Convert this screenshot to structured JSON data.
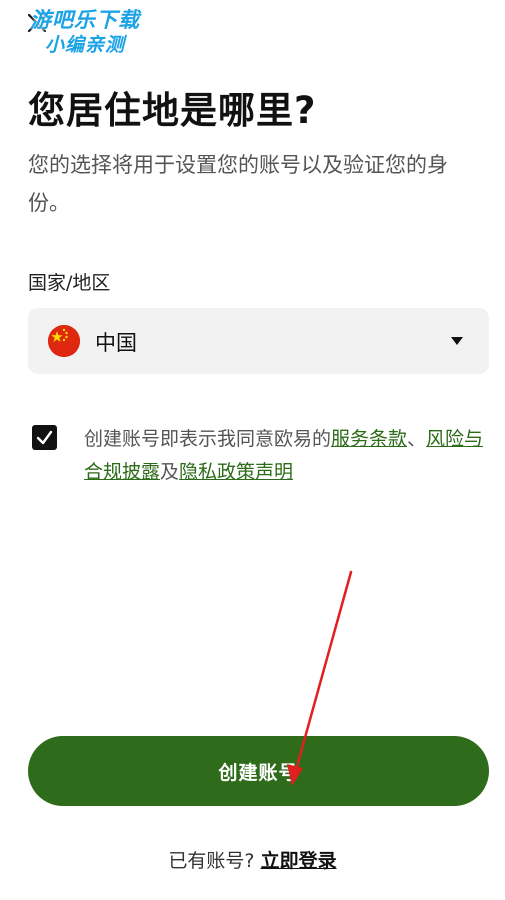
{
  "watermark": {
    "line1": "游吧乐下载",
    "line2": "小编亲测"
  },
  "page": {
    "title": "您居住地是哪里?",
    "subtitle": "您的选择将用于设置您的账号以及验证您的身份。"
  },
  "country": {
    "label": "国家/地区",
    "selected": "中国",
    "flag_icon": "china-flag-icon"
  },
  "terms": {
    "checked": true,
    "prefix": "创建账号即表示我同意欧易的",
    "link_terms": "服务条款",
    "sep1": "、",
    "link_risk": "风险与合规披露",
    "sep2": "及",
    "link_privacy": "隐私政策声明"
  },
  "actions": {
    "create_account": "创建账号",
    "have_account": "已有账号?",
    "login": "立即登录"
  },
  "colors": {
    "brand_green": "#2e6b1a",
    "link_green": "#2c6b18",
    "annotation_arrow": "#e01f1f"
  }
}
